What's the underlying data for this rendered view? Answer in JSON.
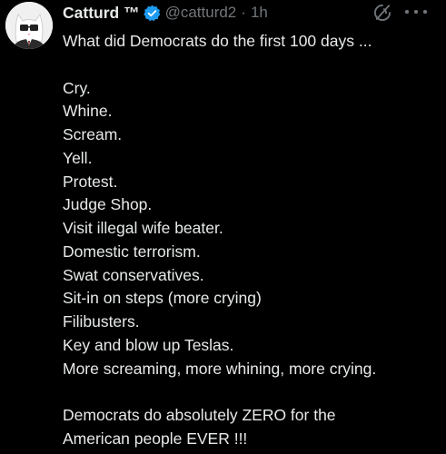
{
  "tweet": {
    "author": {
      "display_name": "Catturd ™",
      "handle": "@catturd2",
      "separator": "·",
      "time": "1h",
      "verified": true,
      "avatar_icon": "cat-avatar-icon"
    },
    "icons": {
      "verified": "verified-badge-icon",
      "grok": "grok-icon",
      "more": "more-options-icon"
    },
    "colors": {
      "background": "#000000",
      "text": "#e7e9ea",
      "secondary": "#71767b",
      "verified_badge": "#1d9bf0"
    },
    "text": {
      "intro": "What did Democrats do the first 100 days ...",
      "list": [
        "Cry.",
        "Whine.",
        "Scream.",
        "Yell.",
        "Protest.",
        "Judge Shop.",
        "Visit illegal wife beater.",
        "Domestic terrorism.",
        "Swat conservatives.",
        "Sit-in on steps (more crying)",
        "Filibusters.",
        "Key and blow up Teslas.",
        "More screaming, more whining, more crying."
      ],
      "closing": [
        "Democrats do absolutely ZERO for the",
        "American people EVER !!!"
      ]
    }
  }
}
